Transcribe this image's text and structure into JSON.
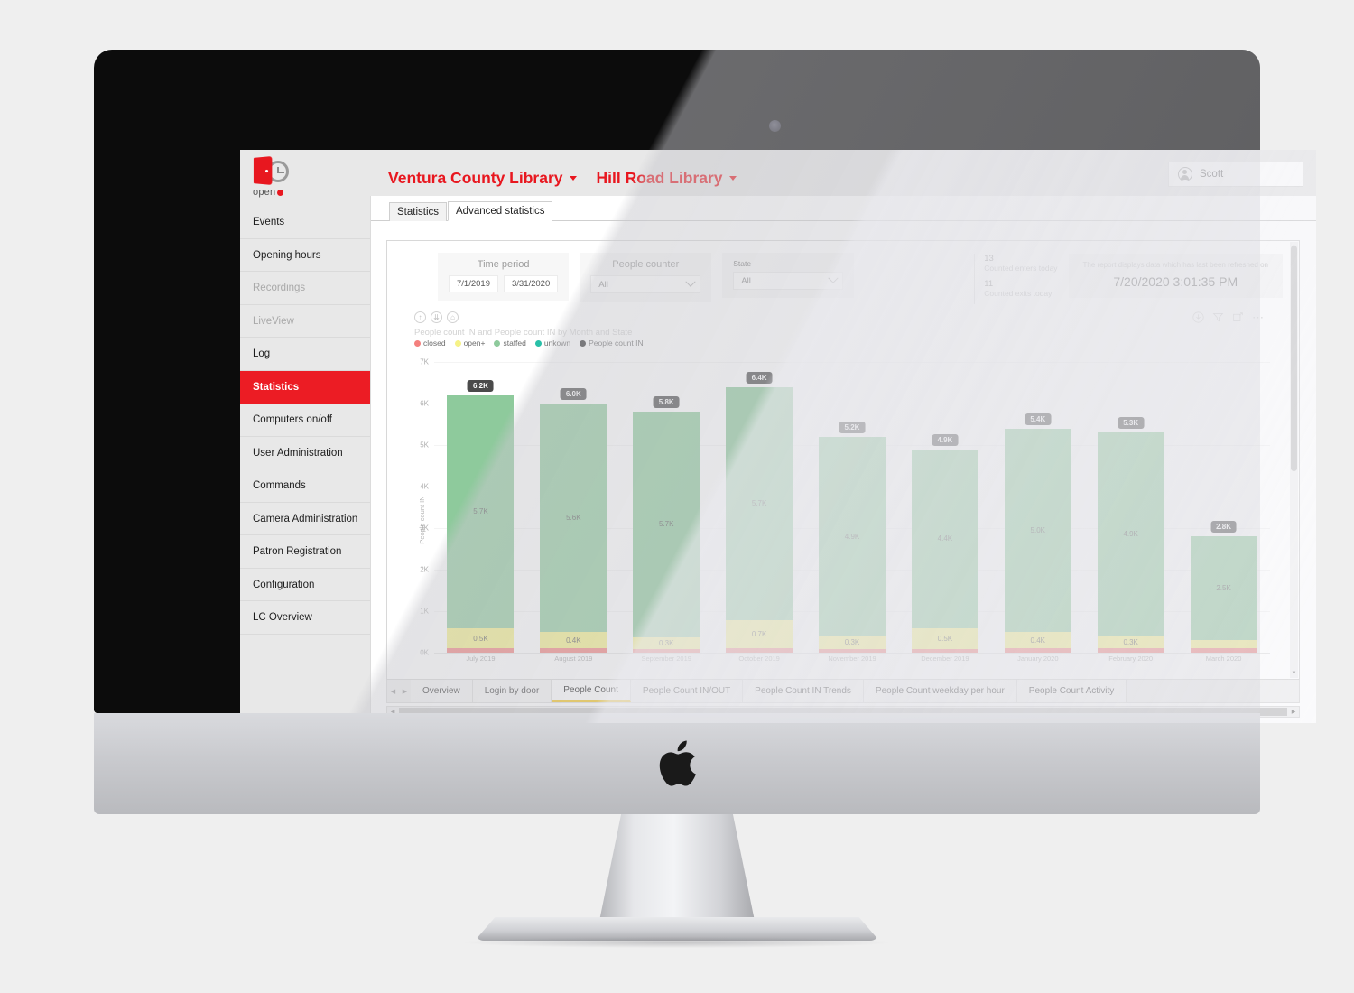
{
  "sidebar": {
    "logo": {
      "word": "open",
      "icon": "open-plus-door-clock-logo"
    },
    "items": [
      {
        "label": "Events",
        "state": "normal"
      },
      {
        "label": "Opening hours",
        "state": "normal"
      },
      {
        "label": "Recordings",
        "state": "disabled"
      },
      {
        "label": "LiveView",
        "state": "disabled"
      },
      {
        "label": "Log",
        "state": "normal"
      },
      {
        "label": "Statistics",
        "state": "active"
      },
      {
        "label": "Computers on/off",
        "state": "normal"
      },
      {
        "label": "User Administration",
        "state": "normal"
      },
      {
        "label": "Commands",
        "state": "normal"
      },
      {
        "label": "Camera Administration",
        "state": "normal"
      },
      {
        "label": "Patron Registration",
        "state": "normal"
      },
      {
        "label": "Configuration",
        "state": "normal"
      },
      {
        "label": "LC Overview",
        "state": "normal"
      }
    ]
  },
  "header": {
    "org": "Ventura County Library",
    "branch": "Hill Road Library",
    "user": "Scott"
  },
  "tabs": {
    "statistics": "Statistics",
    "advanced": "Advanced statistics"
  },
  "filters": {
    "time_period": {
      "label": "Time period",
      "from": "7/1/2019",
      "to": "3/31/2020"
    },
    "people_counter": {
      "label": "People counter",
      "value": "All"
    },
    "state": {
      "label": "State",
      "value": "All"
    }
  },
  "kpis": {
    "enters_value": "13",
    "enters_label": "Counted enters today",
    "exits_value": "11",
    "exits_label": "Counted exits today"
  },
  "refresh": {
    "note": "The report displays data which has last been refreshed on",
    "timestamp": "7/20/2020 3:01:35 PM"
  },
  "visual_tools": {
    "left": [
      "drill-up-icon",
      "drill-down-icon",
      "expand-hierarchy-icon"
    ],
    "right": [
      "download-icon",
      "filter-icon",
      "focus-mode-icon",
      "more-options-icon"
    ]
  },
  "page_tabs": [
    {
      "label": "Overview",
      "active": false
    },
    {
      "label": "Login by door",
      "active": false
    },
    {
      "label": "People Count",
      "active": true
    },
    {
      "label": "People Count IN/OUT",
      "active": false
    },
    {
      "label": "People Count IN Trends",
      "active": false
    },
    {
      "label": "People Count weekday per hour",
      "active": false
    },
    {
      "label": "People Count Activity",
      "active": false
    }
  ],
  "chart_data": {
    "type": "bar",
    "stacked": true,
    "title": "People count IN and People count IN by Month and State",
    "xlabel": "",
    "ylabel": "People count IN",
    "ylim": [
      0,
      7000
    ],
    "ytick_labels": [
      "0K",
      "1K",
      "2K",
      "3K",
      "4K",
      "5K",
      "6K",
      "7K"
    ],
    "ytick_values": [
      0,
      1000,
      2000,
      3000,
      4000,
      5000,
      6000,
      7000
    ],
    "grid": true,
    "legend_position": "top-left",
    "legend": [
      {
        "name": "closed",
        "color": "#F4807E"
      },
      {
        "name": "open+",
        "color": "#F6F287"
      },
      {
        "name": "staffed",
        "color": "#8ECA9C"
      },
      {
        "name": "unkown",
        "color": "#29C0A8"
      },
      {
        "name": "People count IN",
        "color": "#2B2B2B"
      }
    ],
    "categories": [
      "July 2019",
      "August 2019",
      "September 2019",
      "October 2019",
      "November 2019",
      "December 2019",
      "January 2020",
      "February 2020",
      "March 2020"
    ],
    "totals": [
      "6.2K",
      "6.0K",
      "5.8K",
      "6.4K",
      "5.2K",
      "4.9K",
      "5.4K",
      "5.3K",
      "2.8K"
    ],
    "total_values": [
      6200,
      6000,
      5800,
      6400,
      5200,
      4900,
      5400,
      5300,
      2800
    ],
    "series": [
      {
        "name": "staffed",
        "color": "#8ECA9C",
        "values": [
          5700,
          5600,
          5700,
          5700,
          4900,
          4400,
          5000,
          4900,
          2500
        ],
        "labels": [
          "5.7K",
          "5.6K",
          "5.7K",
          "5.7K",
          "4.9K",
          "4.4K",
          "5.0K",
          "4.9K",
          "2.5K"
        ]
      },
      {
        "name": "open+",
        "color": "#F6F287",
        "values": [
          500,
          400,
          300,
          700,
          300,
          500,
          400,
          300,
          200
        ],
        "labels": [
          "0.5K",
          "0.4K",
          "0.3K",
          "0.7K",
          "0.3K",
          "0.5K",
          "0.4K",
          "0.3K",
          ""
        ]
      },
      {
        "name": "closed",
        "color": "#F4807E",
        "values": [
          100,
          100,
          100,
          100,
          100,
          100,
          100,
          100,
          100
        ],
        "labels": [
          "",
          "",
          "",
          "",
          "",
          "",
          "",
          "",
          ""
        ]
      }
    ]
  }
}
